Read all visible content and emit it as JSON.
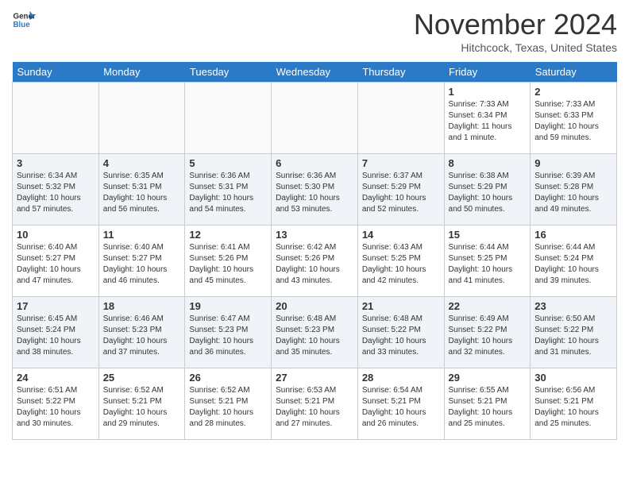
{
  "header": {
    "logo_general": "General",
    "logo_blue": "Blue",
    "month_title": "November 2024",
    "location": "Hitchcock, Texas, United States"
  },
  "days_of_week": [
    "Sunday",
    "Monday",
    "Tuesday",
    "Wednesday",
    "Thursday",
    "Friday",
    "Saturday"
  ],
  "weeks": [
    [
      {
        "num": "",
        "info": ""
      },
      {
        "num": "",
        "info": ""
      },
      {
        "num": "",
        "info": ""
      },
      {
        "num": "",
        "info": ""
      },
      {
        "num": "",
        "info": ""
      },
      {
        "num": "1",
        "info": "Sunrise: 7:33 AM\nSunset: 6:34 PM\nDaylight: 11 hours and 1 minute."
      },
      {
        "num": "2",
        "info": "Sunrise: 7:33 AM\nSunset: 6:33 PM\nDaylight: 10 hours and 59 minutes."
      }
    ],
    [
      {
        "num": "3",
        "info": "Sunrise: 6:34 AM\nSunset: 5:32 PM\nDaylight: 10 hours and 57 minutes."
      },
      {
        "num": "4",
        "info": "Sunrise: 6:35 AM\nSunset: 5:31 PM\nDaylight: 10 hours and 56 minutes."
      },
      {
        "num": "5",
        "info": "Sunrise: 6:36 AM\nSunset: 5:31 PM\nDaylight: 10 hours and 54 minutes."
      },
      {
        "num": "6",
        "info": "Sunrise: 6:36 AM\nSunset: 5:30 PM\nDaylight: 10 hours and 53 minutes."
      },
      {
        "num": "7",
        "info": "Sunrise: 6:37 AM\nSunset: 5:29 PM\nDaylight: 10 hours and 52 minutes."
      },
      {
        "num": "8",
        "info": "Sunrise: 6:38 AM\nSunset: 5:29 PM\nDaylight: 10 hours and 50 minutes."
      },
      {
        "num": "9",
        "info": "Sunrise: 6:39 AM\nSunset: 5:28 PM\nDaylight: 10 hours and 49 minutes."
      }
    ],
    [
      {
        "num": "10",
        "info": "Sunrise: 6:40 AM\nSunset: 5:27 PM\nDaylight: 10 hours and 47 minutes."
      },
      {
        "num": "11",
        "info": "Sunrise: 6:40 AM\nSunset: 5:27 PM\nDaylight: 10 hours and 46 minutes."
      },
      {
        "num": "12",
        "info": "Sunrise: 6:41 AM\nSunset: 5:26 PM\nDaylight: 10 hours and 45 minutes."
      },
      {
        "num": "13",
        "info": "Sunrise: 6:42 AM\nSunset: 5:26 PM\nDaylight: 10 hours and 43 minutes."
      },
      {
        "num": "14",
        "info": "Sunrise: 6:43 AM\nSunset: 5:25 PM\nDaylight: 10 hours and 42 minutes."
      },
      {
        "num": "15",
        "info": "Sunrise: 6:44 AM\nSunset: 5:25 PM\nDaylight: 10 hours and 41 minutes."
      },
      {
        "num": "16",
        "info": "Sunrise: 6:44 AM\nSunset: 5:24 PM\nDaylight: 10 hours and 39 minutes."
      }
    ],
    [
      {
        "num": "17",
        "info": "Sunrise: 6:45 AM\nSunset: 5:24 PM\nDaylight: 10 hours and 38 minutes."
      },
      {
        "num": "18",
        "info": "Sunrise: 6:46 AM\nSunset: 5:23 PM\nDaylight: 10 hours and 37 minutes."
      },
      {
        "num": "19",
        "info": "Sunrise: 6:47 AM\nSunset: 5:23 PM\nDaylight: 10 hours and 36 minutes."
      },
      {
        "num": "20",
        "info": "Sunrise: 6:48 AM\nSunset: 5:23 PM\nDaylight: 10 hours and 35 minutes."
      },
      {
        "num": "21",
        "info": "Sunrise: 6:48 AM\nSunset: 5:22 PM\nDaylight: 10 hours and 33 minutes."
      },
      {
        "num": "22",
        "info": "Sunrise: 6:49 AM\nSunset: 5:22 PM\nDaylight: 10 hours and 32 minutes."
      },
      {
        "num": "23",
        "info": "Sunrise: 6:50 AM\nSunset: 5:22 PM\nDaylight: 10 hours and 31 minutes."
      }
    ],
    [
      {
        "num": "24",
        "info": "Sunrise: 6:51 AM\nSunset: 5:22 PM\nDaylight: 10 hours and 30 minutes."
      },
      {
        "num": "25",
        "info": "Sunrise: 6:52 AM\nSunset: 5:21 PM\nDaylight: 10 hours and 29 minutes."
      },
      {
        "num": "26",
        "info": "Sunrise: 6:52 AM\nSunset: 5:21 PM\nDaylight: 10 hours and 28 minutes."
      },
      {
        "num": "27",
        "info": "Sunrise: 6:53 AM\nSunset: 5:21 PM\nDaylight: 10 hours and 27 minutes."
      },
      {
        "num": "28",
        "info": "Sunrise: 6:54 AM\nSunset: 5:21 PM\nDaylight: 10 hours and 26 minutes."
      },
      {
        "num": "29",
        "info": "Sunrise: 6:55 AM\nSunset: 5:21 PM\nDaylight: 10 hours and 25 minutes."
      },
      {
        "num": "30",
        "info": "Sunrise: 6:56 AM\nSunset: 5:21 PM\nDaylight: 10 hours and 25 minutes."
      }
    ]
  ]
}
